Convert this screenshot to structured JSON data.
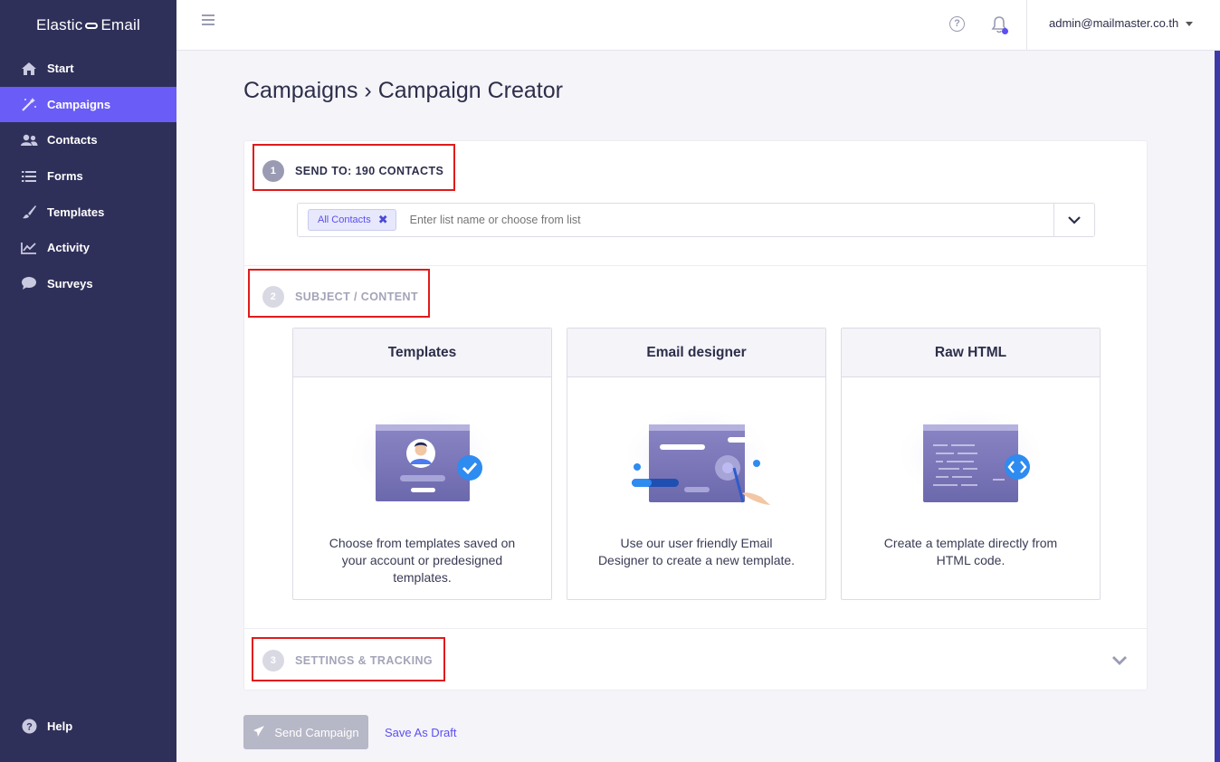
{
  "sidebar": {
    "logo_left": "Elastic",
    "logo_right": "Email",
    "items": [
      {
        "label": "Start",
        "icon": "home-icon"
      },
      {
        "label": "Campaigns",
        "icon": "magic-wand-icon",
        "active": true
      },
      {
        "label": "Contacts",
        "icon": "users-icon"
      },
      {
        "label": "Forms",
        "icon": "list-icon"
      },
      {
        "label": "Templates",
        "icon": "brush-icon"
      },
      {
        "label": "Activity",
        "icon": "line-chart-icon"
      },
      {
        "label": "Surveys",
        "icon": "chat-bubble-icon"
      }
    ],
    "help_label": "Help"
  },
  "topbar": {
    "help_glyph": "?",
    "user_email": "admin@mailmaster.co.th"
  },
  "page": {
    "breadcrumb_parent": "Campaigns",
    "breadcrumb_sep": "›",
    "breadcrumb_current": "Campaign Creator"
  },
  "steps": [
    {
      "number": "1",
      "label": "SEND TO: 190 CONTACTS"
    },
    {
      "number": "2",
      "label": "SUBJECT / CONTENT"
    },
    {
      "number": "3",
      "label": "SETTINGS & TRACKING"
    }
  ],
  "recipients": {
    "chip_label": "All Contacts",
    "placeholder": "Enter list name or choose from list"
  },
  "content_options": [
    {
      "title": "Templates",
      "description": "Choose from templates saved on your account or predesigned templates."
    },
    {
      "title": "Email designer",
      "description": "Use our user friendly Email Designer to create a new template."
    },
    {
      "title": "Raw HTML",
      "description": "Create a template directly from HTML code."
    }
  ],
  "actions": {
    "send_label": "Send Campaign",
    "draft_label": "Save As Draft"
  },
  "colors": {
    "sidebar_bg": "#2f3059",
    "accent": "#6a5cf6",
    "highlight_box": "#e01b1b"
  }
}
